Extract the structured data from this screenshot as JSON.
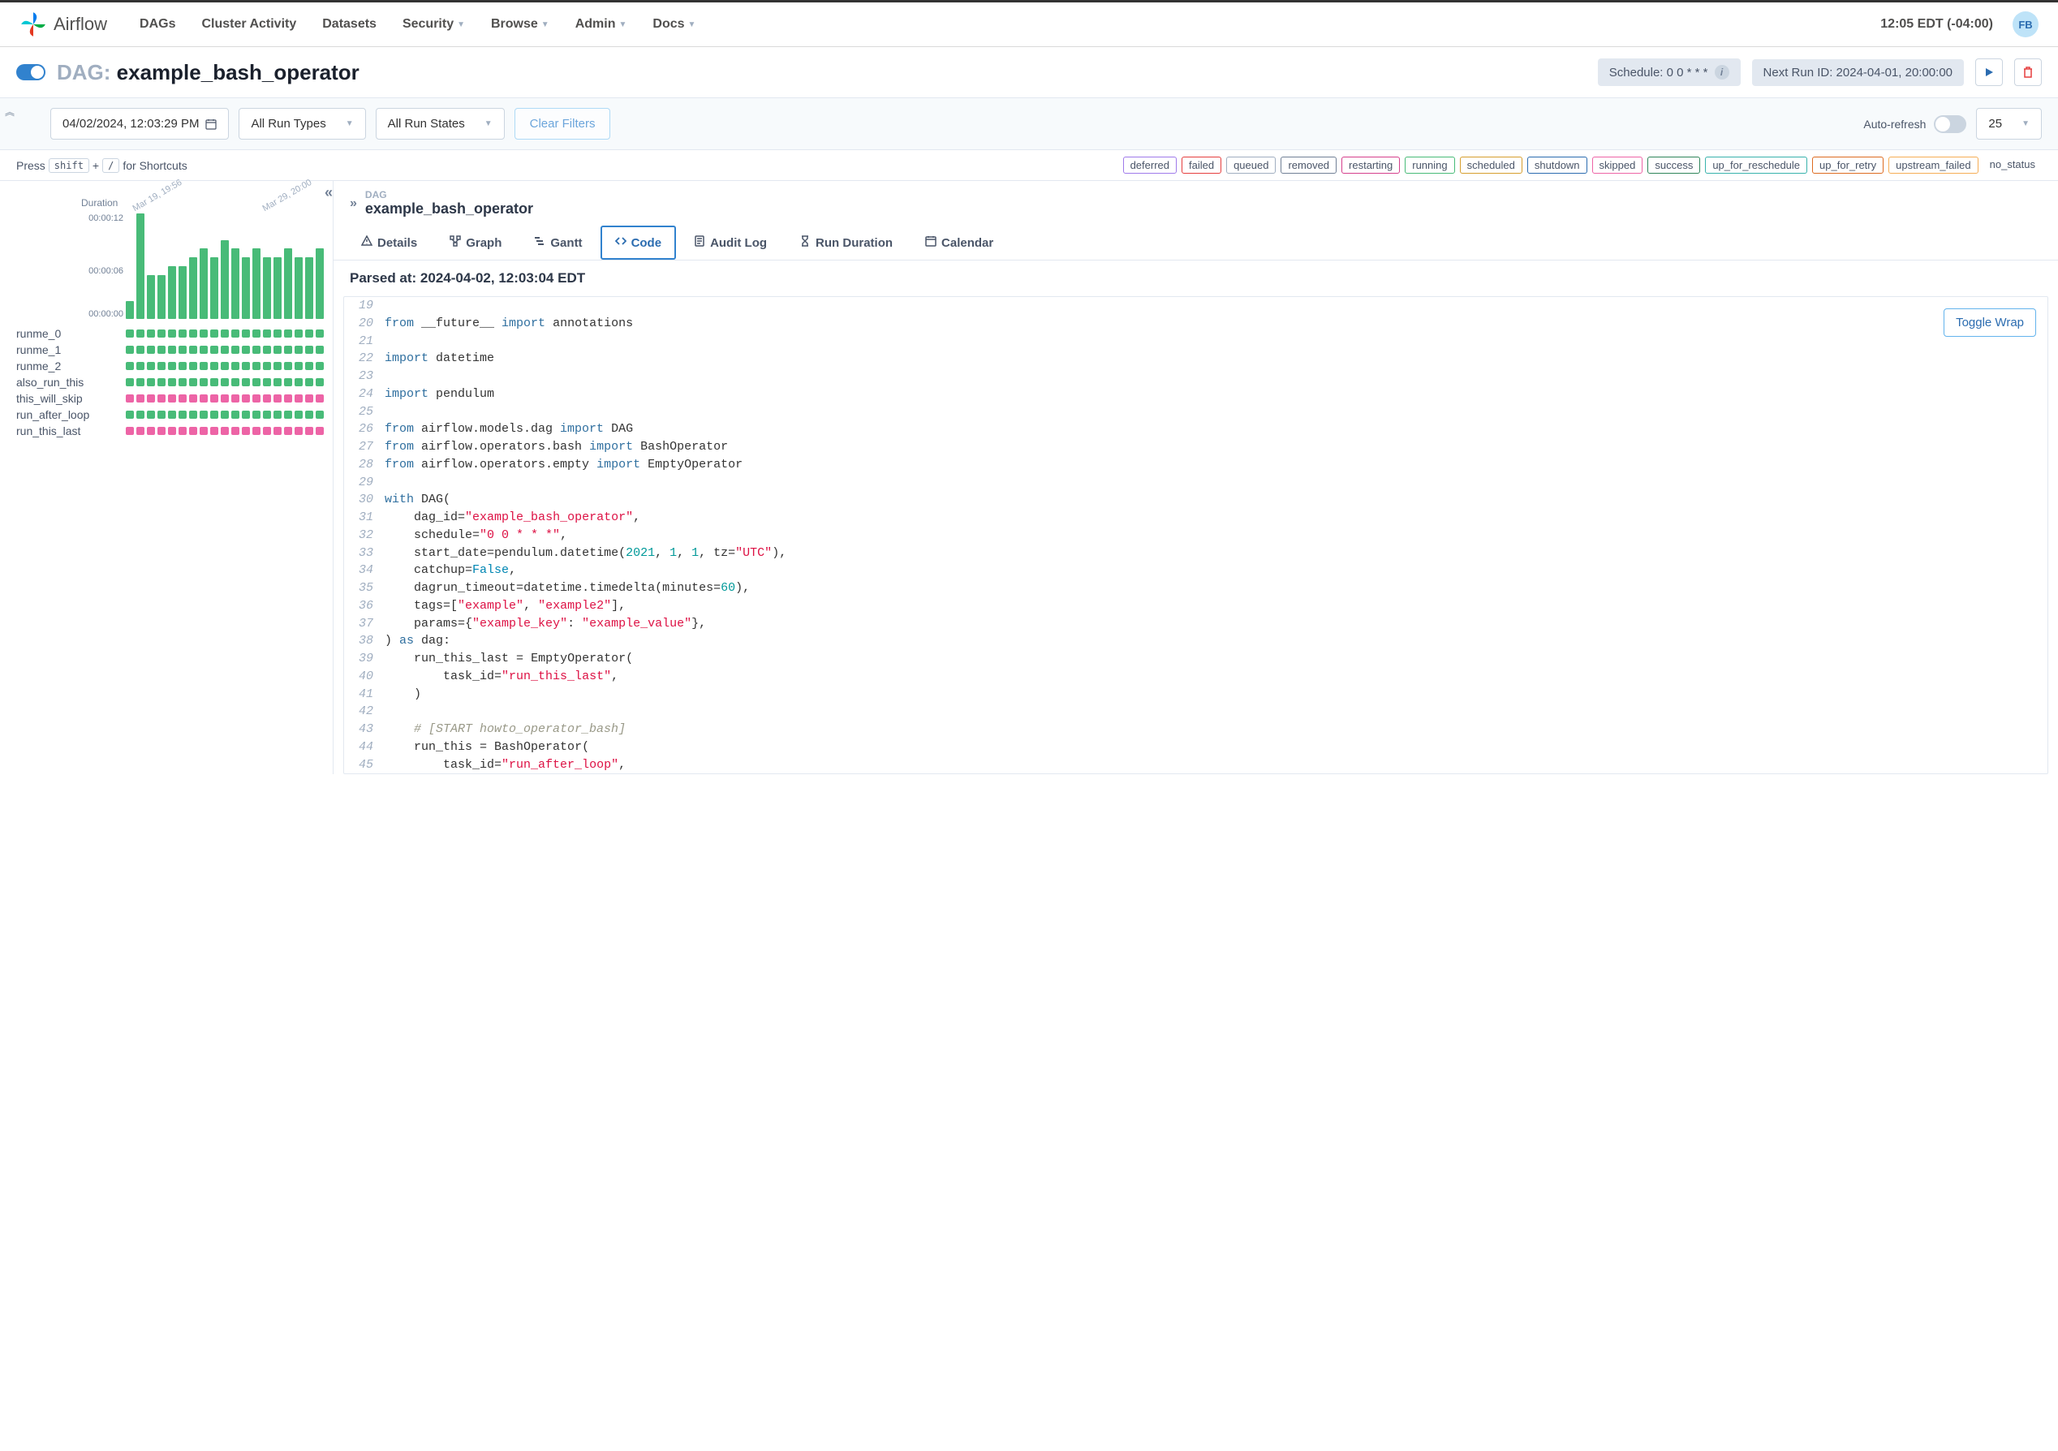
{
  "nav": {
    "app_name": "Airflow",
    "items": [
      "DAGs",
      "Cluster Activity",
      "Datasets",
      "Security",
      "Browse",
      "Admin",
      "Docs"
    ],
    "time": "12:05 EDT (-04:00)",
    "user_initials": "FB"
  },
  "dag": {
    "label": "DAG:",
    "name": "example_bash_operator",
    "schedule_label": "Schedule: 0 0 * * *",
    "next_run_label": "Next Run ID: 2024-04-01, 20:00:00"
  },
  "filters": {
    "date": "04/02/2024, 12:03:29 PM",
    "run_types": "All Run Types",
    "run_states": "All Run States",
    "clear": "Clear Filters",
    "autorefresh": "Auto-refresh",
    "page_size": "25"
  },
  "shortcuts": {
    "prefix": "Press",
    "k1": "shift",
    "plus": "+",
    "k2": "/",
    "suffix": "for Shortcuts"
  },
  "statuses": [
    {
      "label": "deferred",
      "color": "#9f7aea"
    },
    {
      "label": "failed",
      "color": "#e53e3e"
    },
    {
      "label": "queued",
      "color": "#a0aec0"
    },
    {
      "label": "removed",
      "color": "#718096"
    },
    {
      "label": "restarting",
      "color": "#d53f8c"
    },
    {
      "label": "running",
      "color": "#48bb78"
    },
    {
      "label": "scheduled",
      "color": "#d69e2e"
    },
    {
      "label": "shutdown",
      "color": "#2b6cb0"
    },
    {
      "label": "skipped",
      "color": "#ed64a6"
    },
    {
      "label": "success",
      "color": "#2f855a"
    },
    {
      "label": "up_for_reschedule",
      "color": "#38b2ac"
    },
    {
      "label": "up_for_retry",
      "color": "#dd6b20"
    },
    {
      "label": "upstream_failed",
      "color": "#f6ad55"
    },
    {
      "label": "no_status",
      "color": "#a0aec0",
      "border": "transparent"
    }
  ],
  "chart_data": {
    "type": "bar",
    "title": "Duration",
    "ylabels": [
      "00:00:12",
      "00:00:06",
      "00:00:00"
    ],
    "date_labels": [
      "Mar 19, 19:56",
      "Mar 29, 20:00"
    ],
    "values": [
      2,
      12,
      5,
      5,
      6,
      6,
      7,
      8,
      7,
      9,
      8,
      7,
      8,
      7,
      7,
      8,
      7,
      7,
      8
    ],
    "ymax": 12
  },
  "tasks": [
    {
      "name": "runme_0",
      "status": "success"
    },
    {
      "name": "runme_1",
      "status": "success"
    },
    {
      "name": "runme_2",
      "status": "success"
    },
    {
      "name": "also_run_this",
      "status": "success"
    },
    {
      "name": "this_will_skip",
      "status": "skipped"
    },
    {
      "name": "run_after_loop",
      "status": "success"
    },
    {
      "name": "run_this_last",
      "status": "skipped"
    }
  ],
  "num_runs": 19,
  "breadcrumb": {
    "dag_label": "DAG",
    "dag_name": "example_bash_operator"
  },
  "tabs": [
    "Details",
    "Graph",
    "Gantt",
    "Code",
    "Audit Log",
    "Run Duration",
    "Calendar"
  ],
  "active_tab": "Code",
  "parsed_at": "Parsed at: 2024-04-02, 12:03:04 EDT",
  "toggle_wrap": "Toggle Wrap",
  "code": [
    {
      "n": 19,
      "tokens": []
    },
    {
      "n": 20,
      "tokens": [
        [
          "kw",
          "from"
        ],
        [
          "",
          " "
        ],
        [
          "name",
          "__future__"
        ],
        [
          "",
          " "
        ],
        [
          "kw",
          "import"
        ],
        [
          "",
          ""
        ],
        [
          "",
          ""
        ],
        [
          "",
          ""
        ],
        [
          "",
          ""
        ],
        [
          "",
          ""
        ],
        [
          "",
          ""
        ],
        [
          "",
          ""
        ],
        [
          "",
          ""
        ],
        [
          "",
          ""
        ],
        [
          "",
          ""
        ],
        [
          "",
          ""
        ],
        [
          "",
          ""
        ],
        [
          "",
          ""
        ],
        [
          "",
          ""
        ],
        [
          "",
          ""
        ],
        [
          "",
          ""
        ],
        [
          "",
          ""
        ],
        [
          "",
          ""
        ],
        [
          "",
          ""
        ],
        [
          "",
          ""
        ],
        [
          "",
          ""
        ],
        [
          "",
          ""
        ],
        [
          "",
          ""
        ],
        [
          "",
          ""
        ],
        [
          "",
          ""
        ],
        [
          "",
          ""
        ],
        [
          "",
          ""
        ],
        [
          "",
          ""
        ]
      ]
    },
    {
      "n": 20,
      "raw": [
        [
          "kw",
          "from "
        ],
        [
          "name",
          "__future__ "
        ],
        [
          "kw",
          "import "
        ],
        [
          "name",
          "annotations"
        ]
      ]
    },
    {
      "n": 21,
      "raw": []
    },
    {
      "n": 22,
      "raw": [
        [
          "kw",
          "import "
        ],
        [
          "name",
          "datetime"
        ]
      ]
    },
    {
      "n": 23,
      "raw": []
    },
    {
      "n": 24,
      "raw": [
        [
          "kw",
          "import "
        ],
        [
          "name",
          "pendulum"
        ]
      ]
    },
    {
      "n": 25,
      "raw": []
    },
    {
      "n": 26,
      "raw": [
        [
          "kw",
          "from "
        ],
        [
          "name",
          "airflow.models.dag "
        ],
        [
          "kw",
          "import "
        ],
        [
          "name",
          "DAG"
        ]
      ]
    },
    {
      "n": 27,
      "raw": [
        [
          "kw",
          "from "
        ],
        [
          "name",
          "airflow.operators.bash "
        ],
        [
          "kw",
          "import "
        ],
        [
          "name",
          "BashOperator"
        ]
      ]
    },
    {
      "n": 28,
      "raw": [
        [
          "kw",
          "from "
        ],
        [
          "name",
          "airflow.operators.empty "
        ],
        [
          "kw",
          "import "
        ],
        [
          "name",
          "EmptyOperator"
        ]
      ]
    },
    {
      "n": 29,
      "raw": []
    },
    {
      "n": 30,
      "raw": [
        [
          "kw",
          "with "
        ],
        [
          "name",
          "DAG("
        ]
      ]
    },
    {
      "n": 31,
      "raw": [
        [
          "",
          "    "
        ],
        [
          "name",
          "dag_id"
        ],
        [
          "op",
          "="
        ],
        [
          "str",
          "\"example_bash_operator\""
        ],
        [
          "op",
          ","
        ]
      ]
    },
    {
      "n": 32,
      "raw": [
        [
          "",
          "    "
        ],
        [
          "name",
          "schedule"
        ],
        [
          "op",
          "="
        ],
        [
          "str",
          "\"0 0 * * *\""
        ],
        [
          "op",
          ","
        ]
      ]
    },
    {
      "n": 33,
      "raw": [
        [
          "",
          "    "
        ],
        [
          "name",
          "start_date"
        ],
        [
          "op",
          "="
        ],
        [
          "name",
          "pendulum.datetime("
        ],
        [
          "num",
          "2021"
        ],
        [
          "op",
          ", "
        ],
        [
          "num",
          "1"
        ],
        [
          "op",
          ", "
        ],
        [
          "num",
          "1"
        ],
        [
          "op",
          ", tz="
        ],
        [
          "str",
          "\"UTC\""
        ],
        [
          "op",
          "),"
        ]
      ]
    },
    {
      "n": 34,
      "raw": [
        [
          "",
          "    "
        ],
        [
          "name",
          "catchup"
        ],
        [
          "op",
          "="
        ],
        [
          "builtin",
          "False"
        ],
        [
          "op",
          ","
        ]
      ]
    },
    {
      "n": 35,
      "raw": [
        [
          "",
          "    "
        ],
        [
          "name",
          "dagrun_timeout"
        ],
        [
          "op",
          "="
        ],
        [
          "name",
          "datetime.timedelta(minutes"
        ],
        [
          "op",
          "="
        ],
        [
          "num",
          "60"
        ],
        [
          "op",
          "),"
        ]
      ]
    },
    {
      "n": 36,
      "raw": [
        [
          "",
          "    "
        ],
        [
          "name",
          "tags"
        ],
        [
          "op",
          "=["
        ],
        [
          "str",
          "\"example\""
        ],
        [
          "op",
          ", "
        ],
        [
          "str",
          "\"example2\""
        ],
        [
          "op",
          "],"
        ]
      ]
    },
    {
      "n": 37,
      "raw": [
        [
          "",
          "    "
        ],
        [
          "name",
          "params"
        ],
        [
          "op",
          "={"
        ],
        [
          "str",
          "\"example_key\""
        ],
        [
          "op",
          ": "
        ],
        [
          "str",
          "\"example_value\""
        ],
        [
          "op",
          "},"
        ]
      ]
    },
    {
      "n": 38,
      "raw": [
        [
          "op",
          ") "
        ],
        [
          "kw",
          "as "
        ],
        [
          "name",
          "dag:"
        ]
      ]
    },
    {
      "n": 39,
      "raw": [
        [
          "",
          "    "
        ],
        [
          "name",
          "run_this_last "
        ],
        [
          "op",
          "= "
        ],
        [
          "name",
          "EmptyOperator("
        ]
      ]
    },
    {
      "n": 40,
      "raw": [
        [
          "",
          "        "
        ],
        [
          "name",
          "task_id"
        ],
        [
          "op",
          "="
        ],
        [
          "str",
          "\"run_this_last\""
        ],
        [
          "op",
          ","
        ]
      ]
    },
    {
      "n": 41,
      "raw": [
        [
          "",
          "    "
        ],
        [
          "op",
          ")"
        ]
      ]
    },
    {
      "n": 42,
      "raw": []
    },
    {
      "n": 43,
      "raw": [
        [
          "",
          "    "
        ],
        [
          "comment",
          "# [START howto_operator_bash]"
        ]
      ]
    },
    {
      "n": 44,
      "raw": [
        [
          "",
          "    "
        ],
        [
          "name",
          "run_this "
        ],
        [
          "op",
          "= "
        ],
        [
          "name",
          "BashOperator("
        ]
      ]
    },
    {
      "n": 45,
      "raw": [
        [
          "",
          "        "
        ],
        [
          "name",
          "task_id"
        ],
        [
          "op",
          "="
        ],
        [
          "str",
          "\"run_after_loop\""
        ],
        [
          "op",
          ","
        ]
      ]
    }
  ]
}
